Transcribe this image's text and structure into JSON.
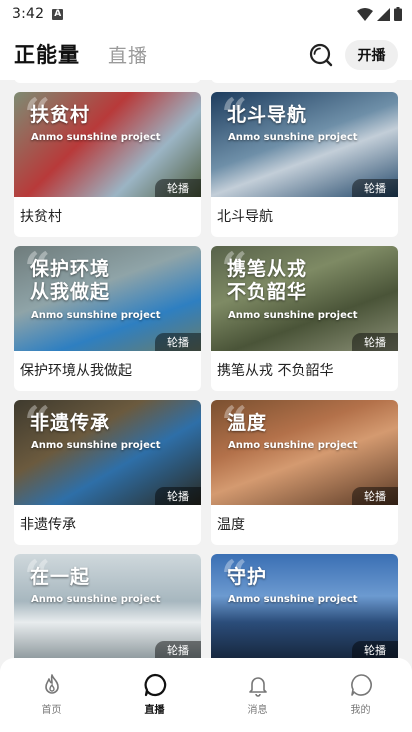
{
  "status_bar": {
    "time": "3:42",
    "notification_glyph": "A"
  },
  "header": {
    "active_tab": "正能量",
    "inactive_tab": "直播",
    "live_button": "开播"
  },
  "colors": {
    "accent": "#111111",
    "muted": "#9a9a9a",
    "badge_bg": "rgba(0,0,0,0.45)"
  },
  "cards": [
    {
      "thumb_line1": "扶贫村",
      "thumb_line2": "",
      "subtitle": "Anmo sunshine project",
      "badge": "轮播",
      "label": "扶贫村",
      "bg": "linear-gradient(135deg,#7e8b73 0%,#b83a3a 40%,#9bb4c4 70%,#4f5e3f 100%)"
    },
    {
      "thumb_line1": "北斗导航",
      "thumb_line2": "",
      "subtitle": "Anmo sunshine project",
      "badge": "轮播",
      "label": "北斗导航",
      "bg": "linear-gradient(160deg,#1d3c5e 0%,#6e8fa8 45%,#c3ced8 60%,#24496b 100%)"
    },
    {
      "thumb_line1": "保护环境",
      "thumb_line2": "从我做起",
      "subtitle": "Anmo sunshine project",
      "badge": "轮播",
      "label": "保护环境从我做起",
      "bg": "linear-gradient(160deg,#6f7c7c 0%,#8fa4a8 40%,#2e7fc1 70%,#6a7d6a 100%)"
    },
    {
      "thumb_line1": "携笔从戎",
      "thumb_line2": "不负韶华",
      "subtitle": "Anmo sunshine project",
      "badge": "轮播",
      "label": "携笔从戎 不负韶华",
      "bg": "linear-gradient(160deg,#58624a 0%,#7e8a64 35%,#4a5438 65%,#8b9077 100%)"
    },
    {
      "thumb_line1": "非遗传承",
      "thumb_line2": "",
      "subtitle": "Anmo sunshine project",
      "badge": "轮播",
      "label": "非遗传承",
      "bg": "linear-gradient(150deg,#3e3a2e 0%,#6b5a3e 35%,#2e6fa8 60%,#2a2a22 100%)"
    },
    {
      "thumb_line1": "温度",
      "thumb_line2": "",
      "subtitle": "Anmo sunshine project",
      "badge": "轮播",
      "label": "温度",
      "bg": "linear-gradient(160deg,#7a5030 0%,#b3714a 35%,#d49a70 55%,#5a3a26 100%)"
    },
    {
      "thumb_line1": "在一起",
      "thumb_line2": "",
      "subtitle": "Anmo sunshine project",
      "badge": "轮播",
      "label": "",
      "bg": "linear-gradient(180deg,#cfd8dc 0%,#a7b7bf 45%,#e8ecee 65%,#8f9a9e 100%)"
    },
    {
      "thumb_line1": "守护",
      "thumb_line2": "",
      "subtitle": "Anmo sunshine project",
      "badge": "轮播",
      "label": "",
      "bg": "linear-gradient(180deg,#3a6fb4 0%,#6c9ad0 40%,#2b4d7a 65%,#17273e 100%)"
    }
  ],
  "tabbar": [
    {
      "label": "首页",
      "icon": "flame-icon",
      "active": false
    },
    {
      "label": "直播",
      "icon": "circle-bubble-icon",
      "active": true
    },
    {
      "label": "消息",
      "icon": "bell-icon",
      "active": false
    },
    {
      "label": "我的",
      "icon": "user-bubble-icon",
      "active": false
    }
  ]
}
